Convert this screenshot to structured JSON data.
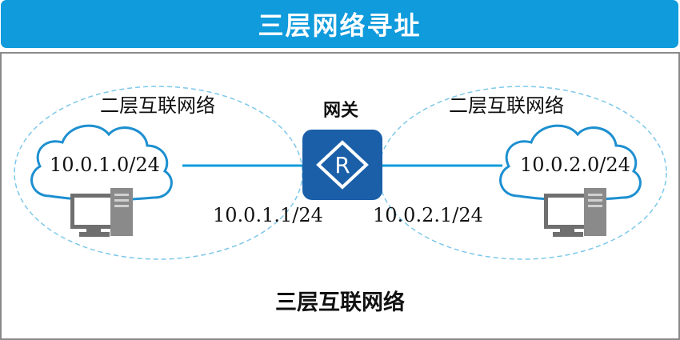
{
  "title": "三层网络寻址",
  "left_zone": {
    "label": "二层互联网络",
    "subnet": "10.0.1.0/24"
  },
  "right_zone": {
    "label": "二层互联网络",
    "subnet": "10.0.2.0/24"
  },
  "gateway": {
    "label": "网关",
    "router_letter": "R"
  },
  "interfaces": {
    "left_ip": "10.0.1.1/24",
    "right_ip": "10.0.2.1/24"
  },
  "bottom_label": "三层互联网络",
  "colors": {
    "title_bg": "#0f9bdc",
    "router_bg": "#1a5fa8",
    "link": "#0f9bdc",
    "zone_border": "#7dc8ea",
    "cloud_border": "#1d8fd0",
    "pc_gray": "#6f6f6f"
  },
  "icons": [
    "cloud-icon",
    "router-icon",
    "pc-icon"
  ]
}
